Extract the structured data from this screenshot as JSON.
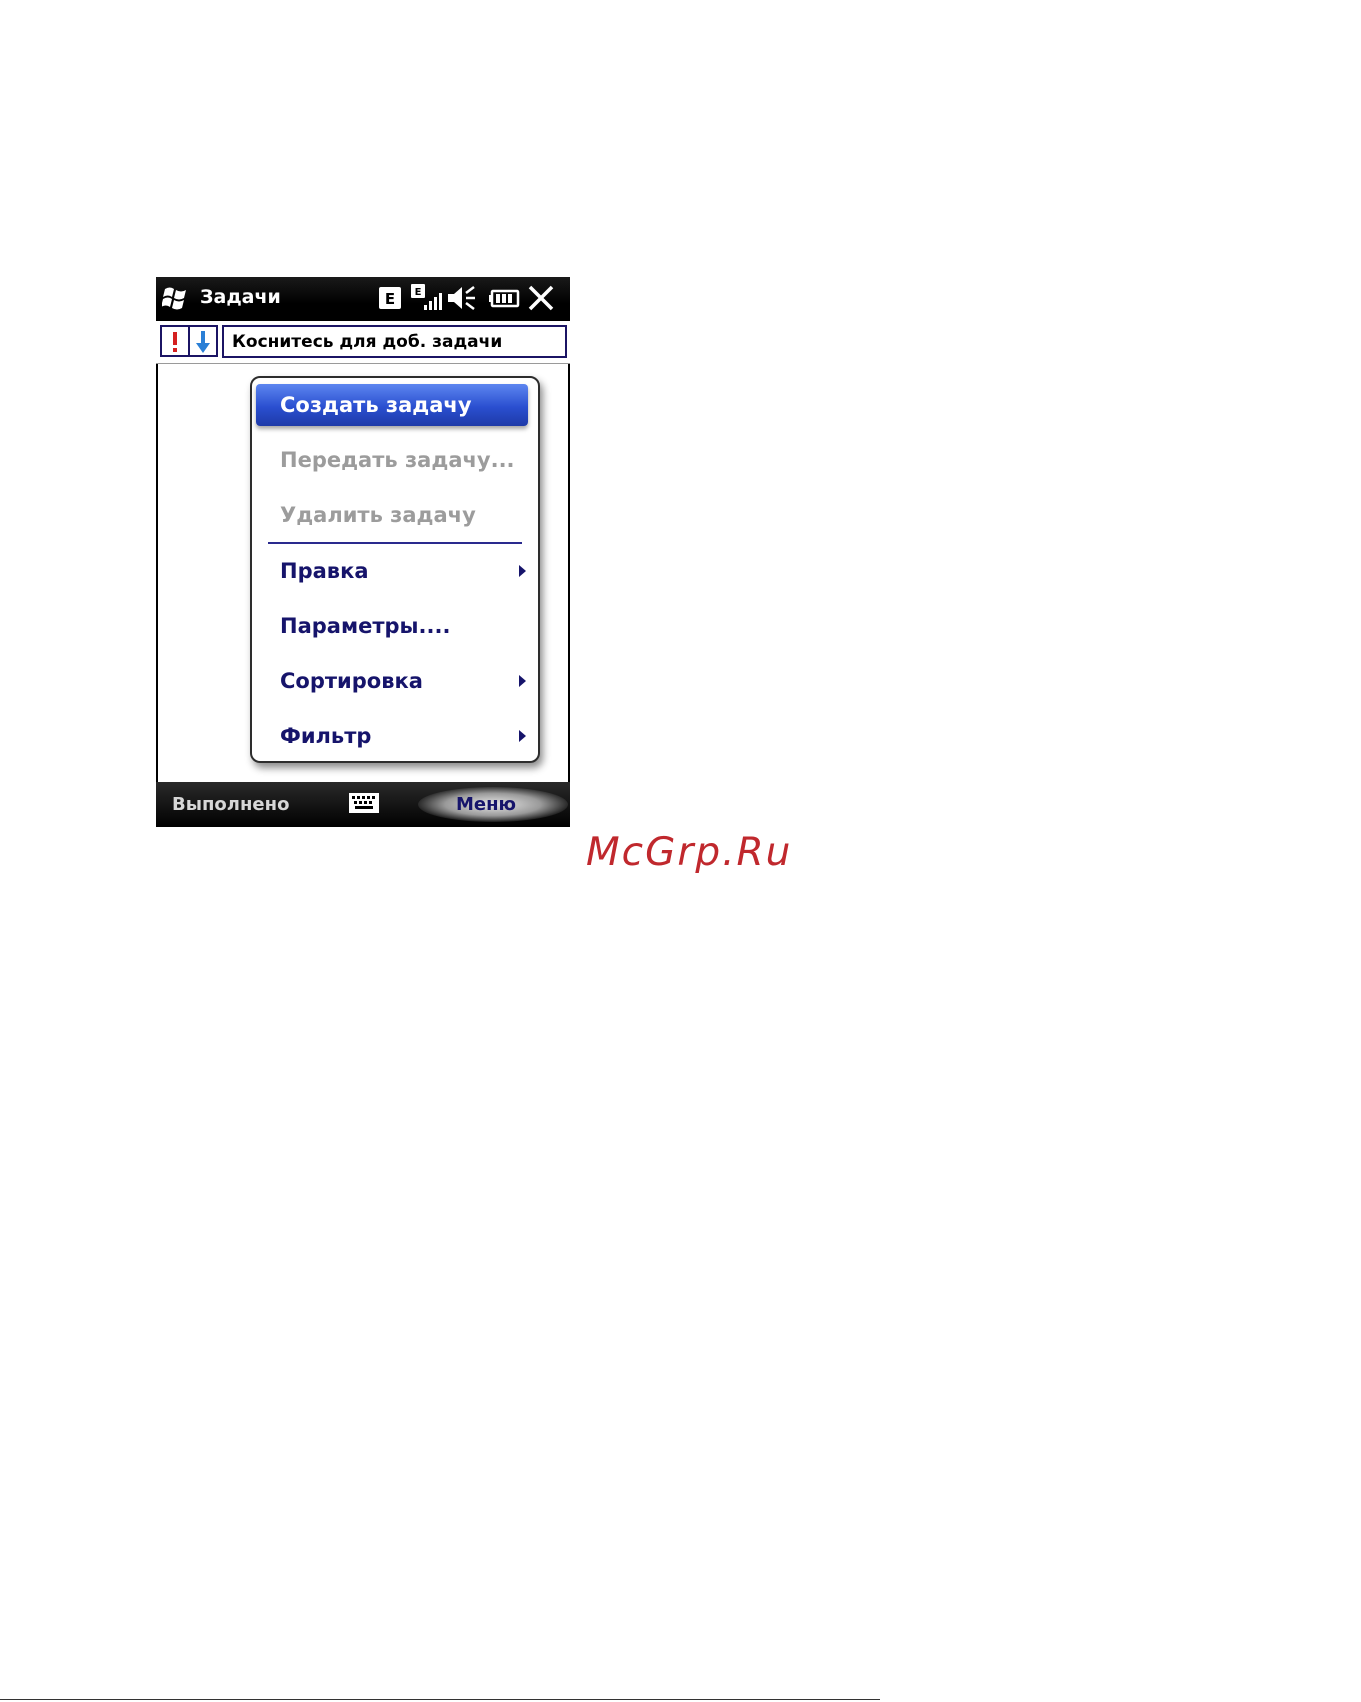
{
  "app": {
    "title": "Задачи",
    "add_task_placeholder": "Коснитесь для доб. задачи"
  },
  "status_bar": {
    "network_badge": "E",
    "signal_badge": "E"
  },
  "menu": {
    "items": [
      {
        "label": "Создать задачу",
        "state": "selected",
        "submenu": false
      },
      {
        "label": "Передать задачу...",
        "state": "disabled",
        "submenu": false
      },
      {
        "label": "Удалить задачу",
        "state": "disabled",
        "submenu": false
      },
      {
        "label": "Правка",
        "state": "enabled",
        "submenu": true
      },
      {
        "label": "Параметры....",
        "state": "enabled",
        "submenu": false
      },
      {
        "label": "Сортировка",
        "state": "enabled",
        "submenu": true
      },
      {
        "label": "Фильтр",
        "state": "enabled",
        "submenu": true
      }
    ]
  },
  "softkeys": {
    "left": "Выполнено",
    "right": "Меню"
  },
  "watermark": "McGrp.Ru",
  "colors": {
    "menu_text": "#16146b",
    "selected_bg": "#2a4fd0",
    "disabled_text": "#9c9c9c",
    "watermark": "#c0282d"
  }
}
